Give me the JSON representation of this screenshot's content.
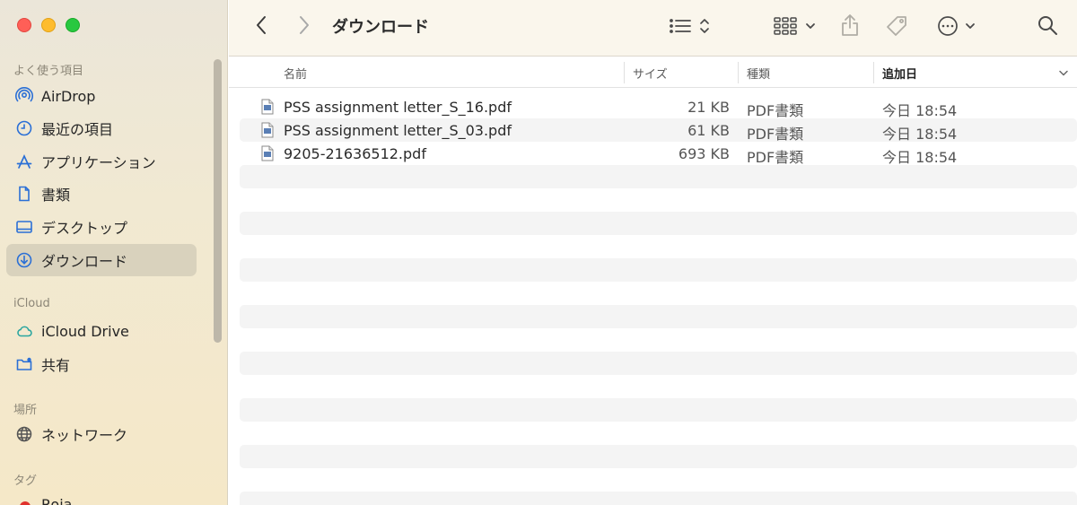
{
  "window": {
    "title": "ダウンロード"
  },
  "sidebar": {
    "favorites_label": "よく使う項目",
    "favorites": [
      {
        "label": "AirDrop",
        "icon": "airdrop-icon"
      },
      {
        "label": "最近の項目",
        "icon": "clock-icon"
      },
      {
        "label": "アプリケーション",
        "icon": "applications-icon"
      },
      {
        "label": "書類",
        "icon": "document-icon"
      },
      {
        "label": "デスクトップ",
        "icon": "desktop-icon"
      },
      {
        "label": "ダウンロード",
        "icon": "download-icon",
        "selected": true
      }
    ],
    "icloud_label": "iCloud",
    "icloud": [
      {
        "label": "iCloud Drive",
        "icon": "cloud-icon"
      },
      {
        "label": "共有",
        "icon": "shared-folder-icon"
      }
    ],
    "locations_label": "場所",
    "locations": [
      {
        "label": "ネットワーク",
        "icon": "globe-icon"
      }
    ],
    "tags_label": "タグ",
    "tags": [
      {
        "label": "Roja",
        "color": "#e0312c"
      }
    ]
  },
  "columns": {
    "name": "名前",
    "size": "サイズ",
    "kind": "種類",
    "date_added": "追加日"
  },
  "files": [
    {
      "name": "PSS assignment letter_S_16.pdf",
      "size": "21 KB",
      "kind": "PDF書類",
      "date": "今日 18:54"
    },
    {
      "name": "PSS assignment letter_S_03.pdf",
      "size": "61 KB",
      "kind": "PDF書類",
      "date": "今日 18:54"
    },
    {
      "name": "9205-21636512.pdf",
      "size": "693 KB",
      "kind": "PDF書類",
      "date": "今日 18:54"
    }
  ],
  "colors": {
    "accent": "#2a6fd6",
    "sidebar_selected": "#d9d2bd",
    "tag_red": "#e0312c"
  }
}
